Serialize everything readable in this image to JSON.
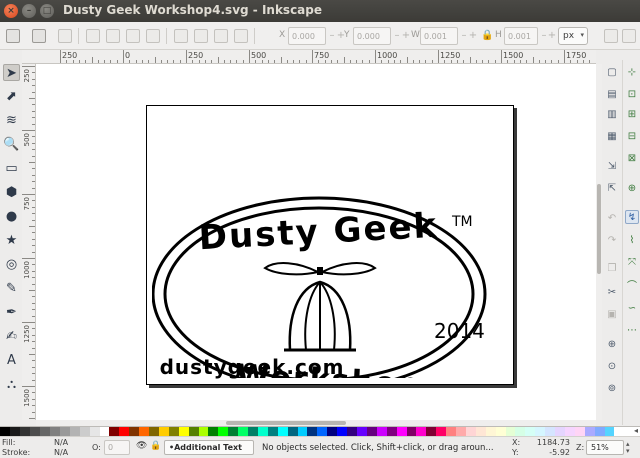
{
  "window": {
    "title": "Dusty Geek Workshop4.svg - Inkscape",
    "close_glyph": "×",
    "minimize_glyph": "–",
    "maximize_glyph": "□"
  },
  "toolbar": {
    "x_label": "X",
    "x_value": "0.000",
    "y_label": "Y",
    "y_value": "0.000",
    "w_label": "W",
    "w_value": "0.001",
    "h_label": "H",
    "h_value": "0.001",
    "spin_minus": "–",
    "spin_plus": "+",
    "unit": "px",
    "caret": "▾"
  },
  "rulers": {
    "h_labels": [
      "250",
      "0",
      "250",
      "500",
      "750",
      "1000",
      "1250",
      "1500",
      "1750"
    ],
    "v_labels": [
      "250",
      "500",
      "750",
      "1000",
      "1250",
      "1500"
    ]
  },
  "artwork": {
    "title_text": "Dusty Geek",
    "bottom_text": "Workshop",
    "year": "2014",
    "trademark": "TM",
    "url": "dustygeek.com"
  },
  "tools": [
    {
      "name": "selector-tool-icon",
      "glyph": "➤"
    },
    {
      "name": "node-tool-icon",
      "glyph": "⬈"
    },
    {
      "name": "tweak-tool-icon",
      "glyph": "≋"
    },
    {
      "name": "zoom-tool-icon",
      "glyph": "🔍"
    },
    {
      "name": "rectangle-tool-icon",
      "glyph": "▭"
    },
    {
      "name": "box-3d-tool-icon",
      "glyph": "⬢"
    },
    {
      "name": "ellipse-tool-icon",
      "glyph": "●"
    },
    {
      "name": "star-tool-icon",
      "glyph": "★"
    },
    {
      "name": "spiral-tool-icon",
      "glyph": "◎"
    },
    {
      "name": "pencil-tool-icon",
      "glyph": "✎"
    },
    {
      "name": "pen-tool-icon",
      "glyph": "✒"
    },
    {
      "name": "calligraphy-tool-icon",
      "glyph": "✍"
    },
    {
      "name": "text-tool-icon",
      "glyph": "A"
    },
    {
      "name": "spray-tool-icon",
      "glyph": "⛬"
    }
  ],
  "statusbar": {
    "fill_label": "Fill:",
    "fill_value": "N/A",
    "stroke_label": "Stroke:",
    "stroke_value": "N/A",
    "opacity_label": "O:",
    "opacity_value": "0",
    "layer_icons": "👁 🔒",
    "layer": "•Additional Text",
    "message": "No objects selected. Click, Shift+click, or drag aroun...",
    "x_label": "X:",
    "x_value": "1184.73",
    "y_label": "Y:",
    "y_value": "-5.92",
    "zoom_label": "Z:",
    "zoom_value": "51%"
  },
  "palette": {
    "colors": [
      "#000000",
      "#1a1a1a",
      "#333333",
      "#4d4d4d",
      "#666666",
      "#808080",
      "#999999",
      "#b3b3b3",
      "#cccccc",
      "#e6e6e6",
      "#ffffff",
      "#800000",
      "#ff0000",
      "#803300",
      "#ff6600",
      "#806600",
      "#ffcc00",
      "#808000",
      "#ffff00",
      "#558000",
      "#aaff00",
      "#008000",
      "#00ff00",
      "#008033",
      "#00ff66",
      "#008066",
      "#00ffcc",
      "#008080",
      "#00ffff",
      "#006680",
      "#00ccff",
      "#003380",
      "#0066ff",
      "#000080",
      "#0000ff",
      "#330080",
      "#6600ff",
      "#660080",
      "#cc00ff",
      "#800080",
      "#ff00ff",
      "#800066",
      "#ff00cc",
      "#800033",
      "#ff0066",
      "#ff8080",
      "#ffaaaa",
      "#ffd5d5",
      "#ffe6d5",
      "#fff6d5",
      "#ffffd5",
      "#e5ffd5",
      "#d5ffe6",
      "#d5fff6",
      "#d5f6ff",
      "#d5e5ff",
      "#e5d5ff",
      "#f6d5ff",
      "#ffd5f6",
      "#aaaaff",
      "#80aaff",
      "#55d4ff"
    ]
  }
}
